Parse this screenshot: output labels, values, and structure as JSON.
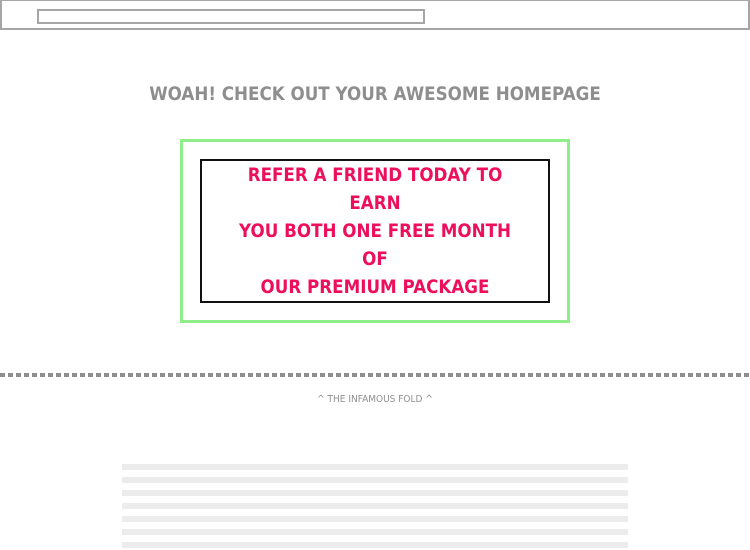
{
  "browser": {
    "address_value": ""
  },
  "hero": {
    "headline": "WOAH! CHECK OUT YOUR AWESOME HOMEPAGE"
  },
  "promo": {
    "lines": [
      "REFER A FRIEND TODAY TO EARN",
      "YOU BOTH ONE FREE MONTH OF",
      "OUR PREMIUM PACKAGE"
    ]
  },
  "fold": {
    "label": "^ THE INFAMOUS FOLD ^"
  },
  "colors": {
    "accent_pink": "#ee0f5c",
    "frame_green": "#8fee8a",
    "text_gray": "#8e8e8e",
    "placeholder_gray": "#ececec"
  }
}
